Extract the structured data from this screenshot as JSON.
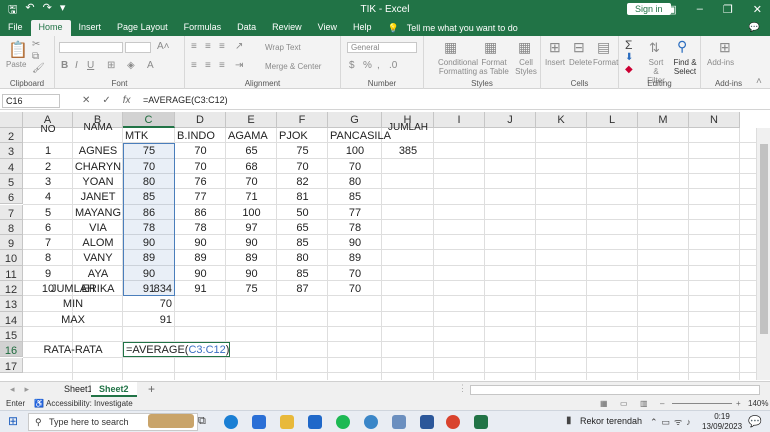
{
  "window": {
    "title": "TIK  -  Excel",
    "signin_label": "Sign in"
  },
  "ribbon_tabs": [
    "File",
    "Home",
    "Insert",
    "Page Layout",
    "Formulas",
    "Data",
    "Review",
    "View",
    "Help"
  ],
  "tell_me": "Tell me what you want to do",
  "ribbon": {
    "clipboard_label": "Clipboard",
    "paste_label": "Paste",
    "font_label": "Font",
    "alignment_label": "Alignment",
    "number_label": "Number",
    "styles_label": "Styles",
    "cells_label": "Cells",
    "editing_label": "Editing",
    "addins_label": "Add-ins",
    "wrap_text": "Wrap Text",
    "merge_center": "Merge & Center",
    "number_format": "General",
    "conditional_formatting": "Conditional Formatting",
    "format_as_table": "Format as Table",
    "cell_styles": "Cell Styles",
    "insert": "Insert",
    "delete": "Delete",
    "format": "Format",
    "sort_filter": "Sort & Filter",
    "find_select": "Find & Select",
    "addins": "Add-ins",
    "bold": "B",
    "italic": "I",
    "underline": "U"
  },
  "formula_bar": {
    "name_box": "C16",
    "cancel": "✕",
    "enter": "✓",
    "fx": "fx",
    "formula": "=AVERAGE(C3:C12)"
  },
  "columns": [
    "A",
    "B",
    "C",
    "D",
    "E",
    "F",
    "G",
    "H",
    "I",
    "J",
    "K",
    "L",
    "M",
    "N"
  ],
  "rows": [
    "2",
    "3",
    "4",
    "5",
    "6",
    "7",
    "8",
    "9",
    "10",
    "11",
    "12",
    "13",
    "14",
    "15",
    "16",
    "17"
  ],
  "row1_partial": {
    "A": "NO",
    "B": "NAMA",
    "H": "JUMLAH"
  },
  "header_row": {
    "C": "MTK",
    "D": "B.INDO",
    "E": "AGAMA",
    "F": "PJOK",
    "G": "PANCASILA"
  },
  "data_rows": [
    {
      "no": "1",
      "nama": "AGNES",
      "mtk": "75",
      "bindo": "70",
      "agama": "65",
      "pjok": "75",
      "pancasila": "100",
      "jumlah": "385"
    },
    {
      "no": "2",
      "nama": "CHARYN",
      "mtk": "70",
      "bindo": "70",
      "agama": "68",
      "pjok": "70",
      "pancasila": "70",
      "jumlah": ""
    },
    {
      "no": "3",
      "nama": "YOAN",
      "mtk": "80",
      "bindo": "76",
      "agama": "70",
      "pjok": "82",
      "pancasila": "80",
      "jumlah": ""
    },
    {
      "no": "4",
      "nama": "JANET",
      "mtk": "85",
      "bindo": "77",
      "agama": "71",
      "pjok": "81",
      "pancasila": "85",
      "jumlah": ""
    },
    {
      "no": "5",
      "nama": "MAYANG",
      "mtk": "86",
      "bindo": "86",
      "agama": "100",
      "pjok": "50",
      "pancasila": "77",
      "jumlah": ""
    },
    {
      "no": "6",
      "nama": "VIA",
      "mtk": "78",
      "bindo": "78",
      "agama": "97",
      "pjok": "65",
      "pancasila": "78",
      "jumlah": ""
    },
    {
      "no": "7",
      "nama": "ALOM",
      "mtk": "90",
      "bindo": "90",
      "agama": "90",
      "pjok": "85",
      "pancasila": "90",
      "jumlah": ""
    },
    {
      "no": "8",
      "nama": "VANY",
      "mtk": "89",
      "bindo": "89",
      "agama": "89",
      "pjok": "80",
      "pancasila": "89",
      "jumlah": ""
    },
    {
      "no": "9",
      "nama": "AYA",
      "mtk": "90",
      "bindo": "90",
      "agama": "90",
      "pjok": "85",
      "pancasila": "70",
      "jumlah": ""
    },
    {
      "no": "10",
      "nama": "ERIKA",
      "mtk": "91",
      "bindo": "91",
      "agama": "75",
      "pjok": "87",
      "pancasila": "70",
      "jumlah": ""
    }
  ],
  "summary": {
    "jumlah_label": "JUMLAH",
    "jumlah_value": "834",
    "min_label": "MIN",
    "min_value": "70",
    "max_label": "MAX",
    "max_value": "91",
    "rata_label": "RATA-RATA",
    "formula_prefix": "=AVERAGE(",
    "formula_ref": "C3:C12",
    "formula_suffix": ")"
  },
  "sheet_tabs": [
    "Sheet1",
    "Sheet2"
  ],
  "active_sheet": "Sheet2",
  "add_sheet": "+",
  "status": {
    "mode": "Enter",
    "accessibility": "Accessibility: Investigate",
    "zoom": "140%"
  },
  "taskbar": {
    "search_placeholder": "Type here to search",
    "weather": "Rekor terendah",
    "time": "0:19",
    "date": "13/09/2023"
  },
  "colors": {
    "excel_green": "#217346",
    "selection_blue": "#4a7ebb",
    "formula_ref": "#3b6fc2"
  }
}
